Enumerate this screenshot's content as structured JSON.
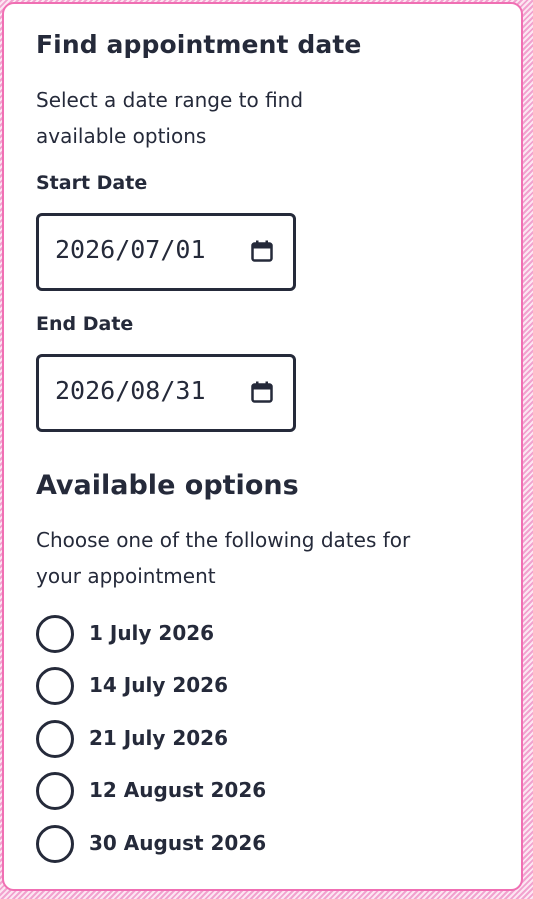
{
  "panel": {
    "title": "Find appointment date",
    "description": "Select a date range to find available options"
  },
  "start_date": {
    "label": "Start Date",
    "value": "2026/07/01",
    "icon": "calendar-icon"
  },
  "end_date": {
    "label": "End Date",
    "value": "2026/08/31",
    "icon": "calendar-icon"
  },
  "options": {
    "heading": "Available options",
    "description": "Choose one of the following dates for your appointment",
    "items": [
      {
        "label": "1 July 2026",
        "selected": false
      },
      {
        "label": "14 July 2026",
        "selected": false
      },
      {
        "label": "21 July 2026",
        "selected": false
      },
      {
        "label": "12 August 2026",
        "selected": false
      },
      {
        "label": "30 August 2026",
        "selected": false
      }
    ]
  },
  "colors": {
    "border_accent": "#f06fb3",
    "text": "#252a3a",
    "background": "#ffffff"
  }
}
